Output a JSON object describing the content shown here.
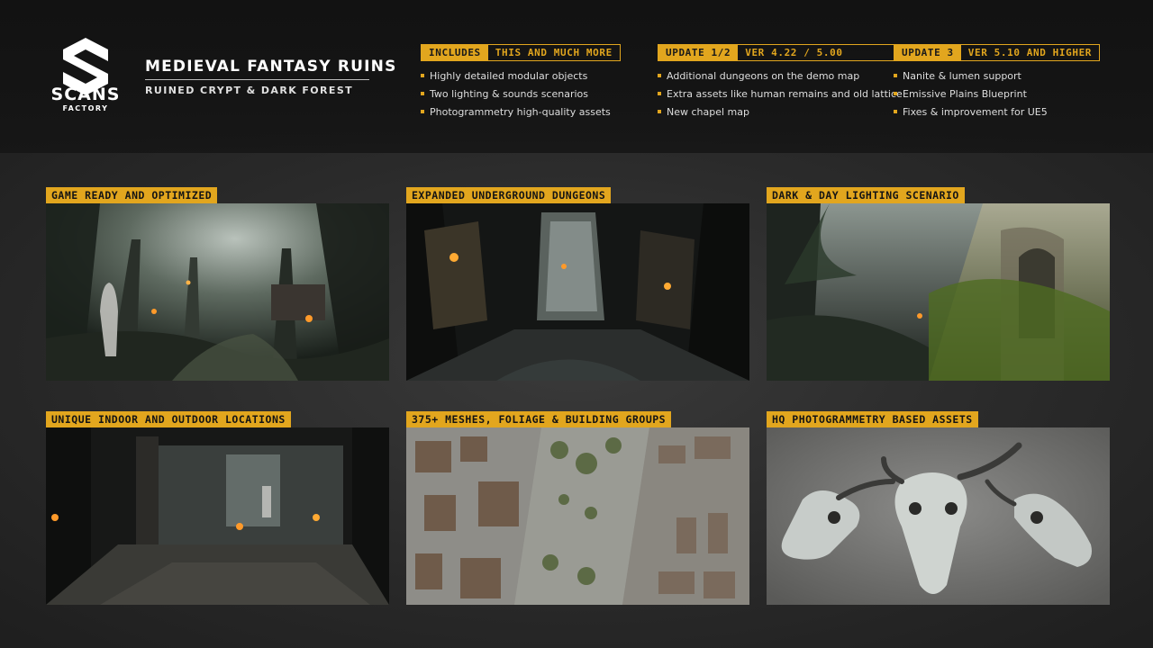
{
  "brand": {
    "logo_word": "SCANS",
    "logo_sub": "FACTORY"
  },
  "header": {
    "title": "MEDIEVAL FANTASY RUINS",
    "subtitle": "RUINED CRYPT & DARK FOREST"
  },
  "features": [
    {
      "tag_label": "INCLUDES",
      "tag_value": "THIS AND MUCH MORE",
      "items": [
        "Highly detailed modular objects",
        "Two lighting & sounds scenarios",
        "Photogrammetry high-quality assets"
      ]
    },
    {
      "tag_label": "UPDATE 1/2",
      "tag_value": "VER 4.22 / 5.00",
      "items": [
        "Additional dungeons on the demo map",
        "Extra assets like human remains and old lattice",
        "New chapel map"
      ]
    },
    {
      "tag_label": "UPDATE 3",
      "tag_value": "VER 5.10 AND HIGHER",
      "items": [
        "Nanite & lumen support",
        "Emissive Plains Blueprint",
        "Fixes & improvement for UE5"
      ]
    }
  ],
  "panels": [
    {
      "label": "GAME READY AND OPTIMIZED"
    },
    {
      "label": "EXPANDED UNDERGROUND DUNGEONS"
    },
    {
      "label": "DARK & DAY LIGHTING SCENARIO"
    },
    {
      "label": "UNIQUE INDOOR AND OUTDOOR LOCATIONS"
    },
    {
      "label": "375+ MESHES, FOLIAGE & BUILDING GROUPS"
    },
    {
      "label": "HQ PHOTOGRAMMETRY BASED ASSETS"
    }
  ],
  "colors": {
    "accent": "#e2a61e",
    "background": "#262626",
    "header": "#121212"
  }
}
